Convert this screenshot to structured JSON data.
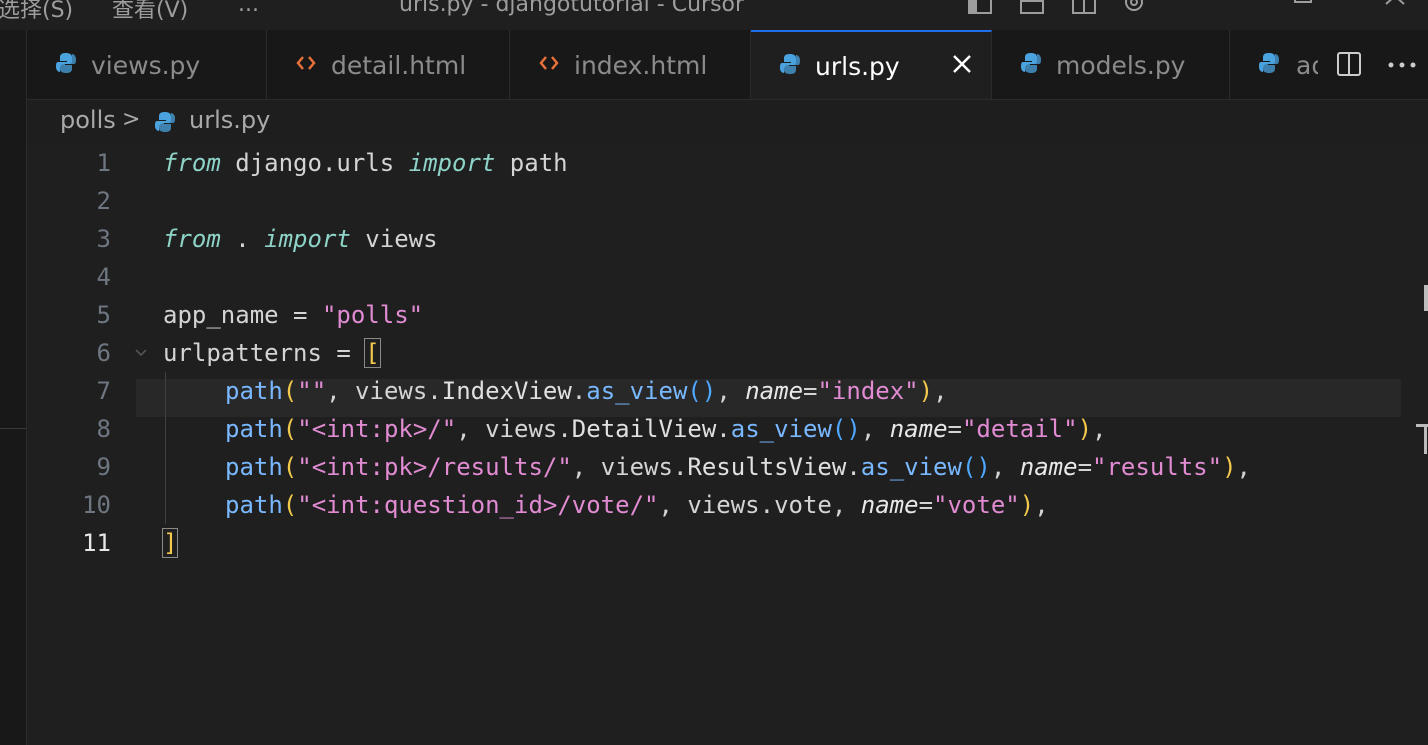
{
  "titlebar": {
    "menu_select": "选择(S)",
    "menu_view": "查看(V)",
    "menu_more": "...",
    "window_title": "urls.py - djangotutorial - Cursor"
  },
  "tabs": [
    {
      "label": "views.py",
      "icon": "python-icon",
      "active": false
    },
    {
      "label": "detail.html",
      "icon": "html-icon",
      "active": false
    },
    {
      "label": "index.html",
      "icon": "html-icon",
      "active": false
    },
    {
      "label": "urls.py",
      "icon": "python-icon",
      "active": true
    },
    {
      "label": "models.py",
      "icon": "python-icon",
      "active": false
    },
    {
      "label": "ad",
      "icon": "python-icon",
      "active": false
    }
  ],
  "breadcrumb": {
    "folder": "polls",
    "separator": ">",
    "file": "urls.py"
  },
  "editor": {
    "active_line": 11,
    "line_numbers": [
      "1",
      "2",
      "3",
      "4",
      "5",
      "6",
      "7",
      "8",
      "9",
      "10",
      "11"
    ],
    "tokens": {
      "l1": [
        "from",
        " django.urls ",
        "import",
        " path"
      ],
      "l3": [
        "from",
        " . ",
        "import",
        " views"
      ],
      "l5": [
        "app_name = ",
        "\"polls\""
      ],
      "l6": [
        "urlpatterns = ",
        "["
      ],
      "l7": [
        "path",
        "(",
        "\"\"",
        ", views.",
        "IndexView",
        ".",
        "as_view",
        "()",
        ", ",
        "name",
        "=",
        "\"index\"",
        ")",
        ","
      ],
      "l8": [
        "path",
        "(",
        "\"<int:pk>/\"",
        ", views.",
        "DetailView",
        ".",
        "as_view",
        "()",
        ", ",
        "name",
        "=",
        "\"detail\"",
        ")",
        ","
      ],
      "l9": [
        "path",
        "(",
        "\"<int:pk>/results/\"",
        ", views.",
        "ResultsView",
        ".",
        "as_view",
        "()",
        ", ",
        "name",
        "=",
        "\"results\"",
        ")",
        ","
      ],
      "l10": [
        "path",
        "(",
        "\"<int:question_id>/vote/\"",
        ", views.vote, ",
        "name",
        "=",
        "\"vote\"",
        ")",
        ","
      ],
      "l11": [
        "]"
      ]
    }
  },
  "colors": {
    "keyword": "#8dd3c7",
    "string": "#e18bd2",
    "function": "#79b8ff",
    "bracket": "#f2c94c",
    "accent": "#1f6feb"
  }
}
